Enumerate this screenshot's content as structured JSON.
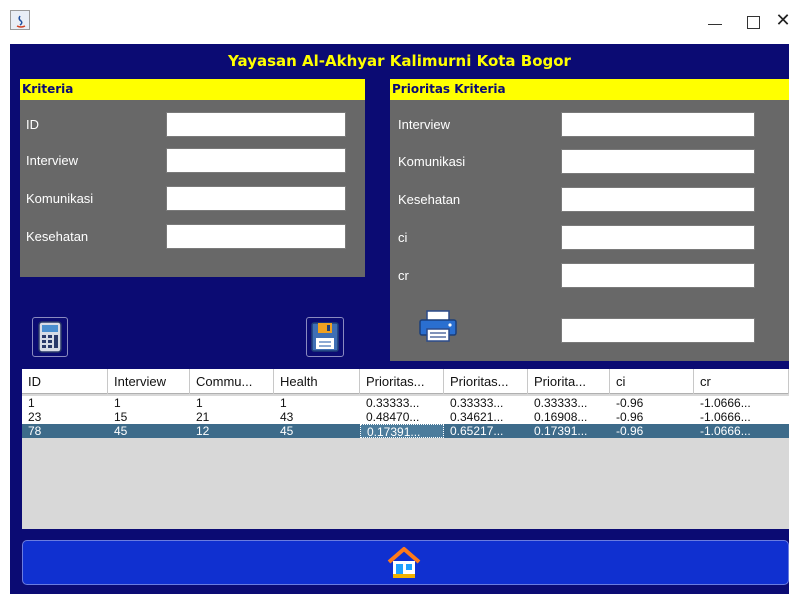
{
  "app": {
    "title": "Yayasan Al-Akhyar Kalimurni Kota Bogor"
  },
  "window": {
    "close_glyph": "✕"
  },
  "colors": {
    "background": "#0b0b73",
    "panel": "#686868",
    "header": "#ffff00",
    "selection": "#3d6b8a",
    "home_bar": "#1030d0"
  },
  "kriteria": {
    "header": "Kriteria",
    "fields": [
      {
        "label": "ID",
        "value": ""
      },
      {
        "label": "Interview",
        "value": ""
      },
      {
        "label": "Komunikasi",
        "value": ""
      },
      {
        "label": "Kesehatan",
        "value": ""
      }
    ]
  },
  "prioritas": {
    "header": "Prioritas Kriteria",
    "fields": [
      {
        "label": "Interview",
        "value": ""
      },
      {
        "label": "Komunikasi",
        "value": ""
      },
      {
        "label": "Kesehatan",
        "value": ""
      },
      {
        "label": "ci",
        "value": ""
      },
      {
        "label": "cr",
        "value": ""
      }
    ],
    "extra_field_value": ""
  },
  "icons": {
    "calculate": "calculator-icon",
    "save": "floppy-disk-icon",
    "print": "printer-icon",
    "home": "home-icon"
  },
  "table": {
    "columns": [
      "ID",
      "Interview",
      "Commu...",
      "Health",
      "Prioritas...",
      "Prioritas...",
      "Priorita...",
      "ci",
      "cr"
    ],
    "rows": [
      [
        "1",
        "1",
        "1",
        "1",
        "0.33333...",
        "0.33333...",
        "0.33333...",
        "-0.96",
        "-1.0666..."
      ],
      [
        "23",
        "15",
        "21",
        "43",
        "0.48470...",
        "0.34621...",
        "0.16908...",
        "-0.96",
        "-1.0666..."
      ],
      [
        "78",
        "45",
        "12",
        "45",
        "0.17391...",
        "0.65217...",
        "0.17391...",
        "-0.96",
        "-1.0666..."
      ]
    ],
    "selected_row": 2
  }
}
